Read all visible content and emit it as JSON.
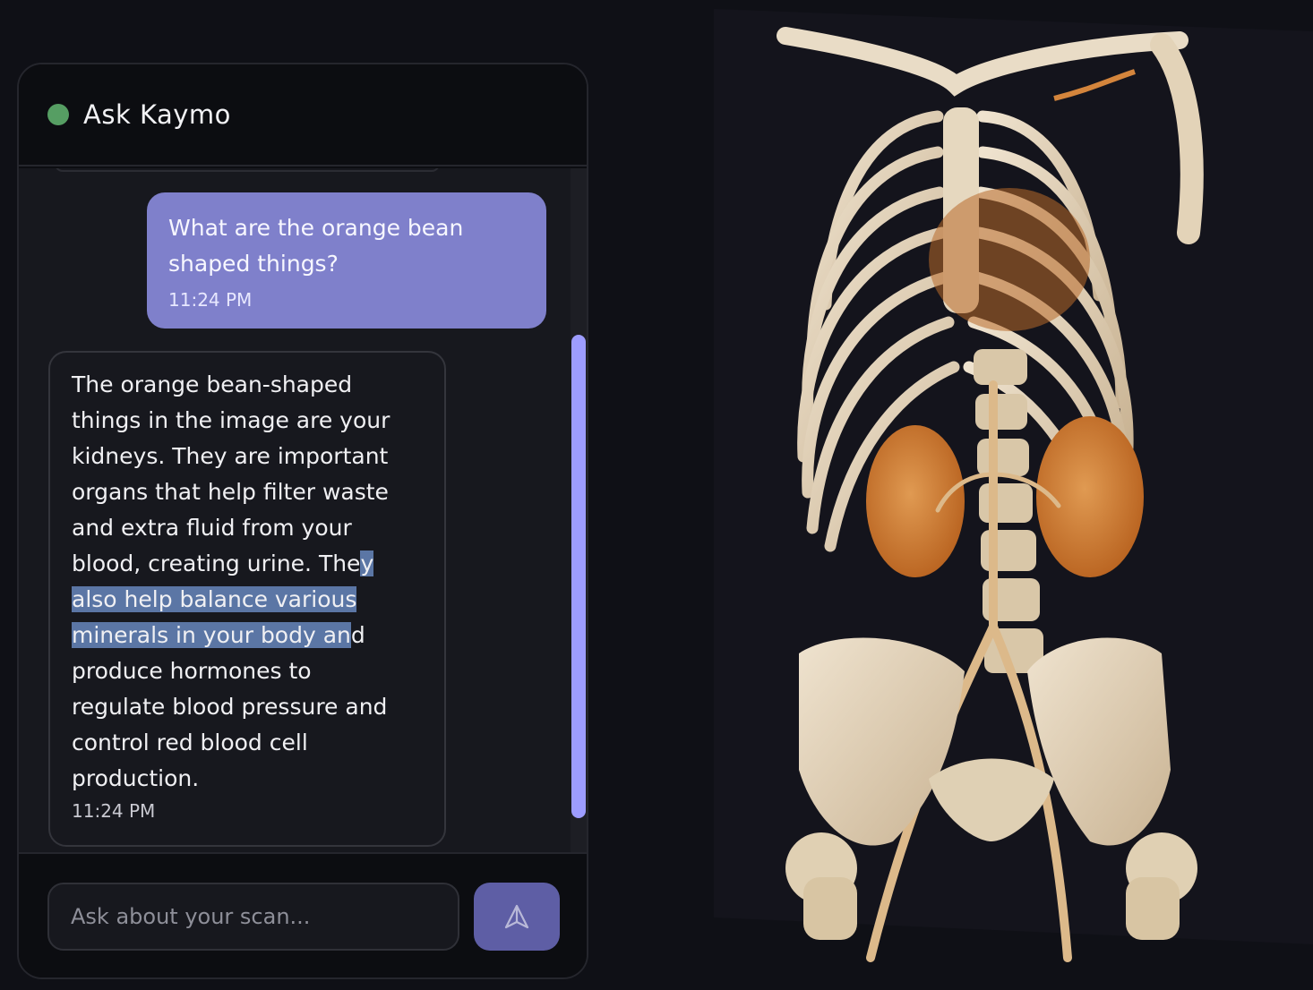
{
  "chat": {
    "title": "Ask Kaymo",
    "status_color": "#569e63",
    "messages": {
      "user": {
        "lines": [
          "What are the orange bean",
          "shaped things?"
        ],
        "time": "11:24 PM"
      },
      "bot": {
        "lines": [
          "The orange bean-shaped",
          "things in the image are your",
          "kidneys. They are important",
          "organs that help filter waste",
          "and extra fluid from your",
          "blood, creating urine. They",
          "also help balance various",
          "minerals in your body and",
          "produce hormones to",
          "regulate blood pressure and",
          "control red blood cell",
          "production."
        ],
        "selected_text": "y also help balance various minerals in your body an",
        "time": "11:24 PM"
      }
    },
    "input": {
      "placeholder": "Ask about your scan...",
      "value": ""
    },
    "send_icon": "send-arrow-icon",
    "accent_color": "#7f80cb",
    "scroll_thumb_color": "#9d9cff"
  },
  "scan": {
    "description_icon": "3d-ct-volume-render",
    "highlight_color": "#d5843a"
  }
}
